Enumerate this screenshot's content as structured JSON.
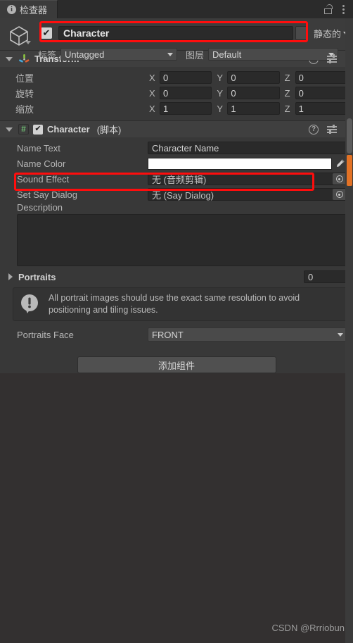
{
  "window": {
    "tab_label": "检查器",
    "tab_icon": "info-icon",
    "lock_icon": "lock-icon",
    "menu_icon": "kebab-menu-icon"
  },
  "gameobject": {
    "icon": "cube-icon",
    "enabled_check": "✔",
    "name": "Character",
    "static_label": "静态的",
    "tag_label": "标签",
    "tag_value": "Untagged",
    "layer_label": "图层",
    "layer_value": "Default"
  },
  "transform": {
    "title": "Transform",
    "icon": "transform-axis-icon",
    "help_icon": "?",
    "rows": [
      {
        "label": "位置",
        "x": "0",
        "y": "0",
        "z": "0"
      },
      {
        "label": "旋转",
        "x": "0",
        "y": "0",
        "z": "0"
      },
      {
        "label": "缩放",
        "x": "1",
        "y": "1",
        "z": "1"
      }
    ],
    "axis_x": "X",
    "axis_y": "Y",
    "axis_z": "Z"
  },
  "character": {
    "title": "Character",
    "subtitle": "(脚本)",
    "script_icon": "#",
    "enabled_check": "✔",
    "help_icon": "?",
    "fields": {
      "name_text_label": "Name Text",
      "name_text_value": "Character Name",
      "name_color_label": "Name Color",
      "name_color_value": "#FFFFFF",
      "sound_effect_label": "Sound Effect",
      "sound_effect_value": "无 (音频剪辑)",
      "set_say_dialog_label": "Set Say Dialog",
      "set_say_dialog_value": "无 (Say Dialog)",
      "description_label": "Description",
      "description_value": ""
    },
    "portraits": {
      "label": "Portraits",
      "count": "0",
      "warning": "All portrait images should use the exact same resolution to avoid positioning and tiling issues.",
      "warning_icon": "warning-icon",
      "face_label": "Portraits Face",
      "face_value": "FRONT"
    }
  },
  "footer": {
    "add_component_label": "添加组件",
    "watermark": "CSDN @Rrriobun"
  },
  "colors": {
    "accent": "#e37225",
    "annotation": "#ff0d0d",
    "panel": "#383838",
    "field": "#2a2a2a"
  }
}
